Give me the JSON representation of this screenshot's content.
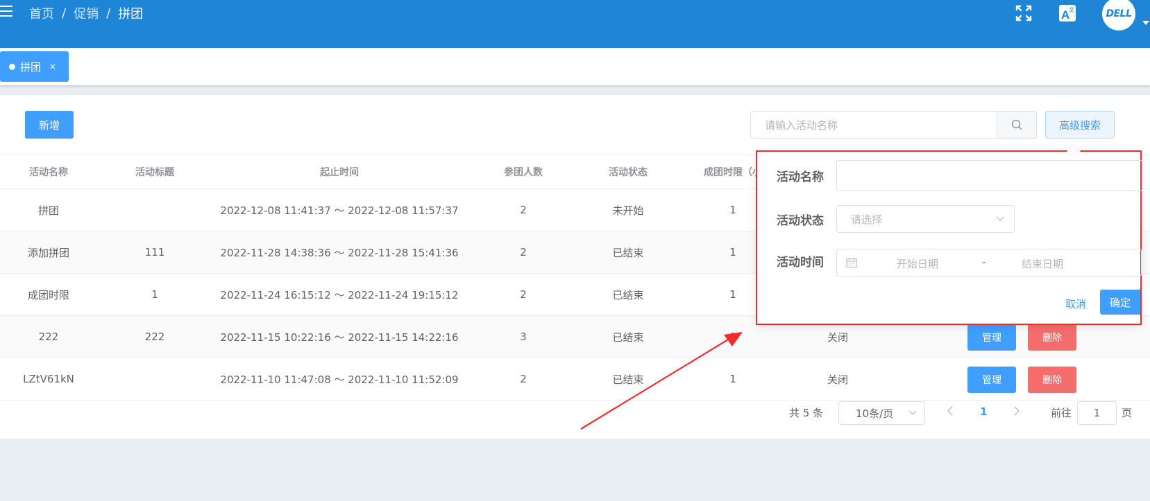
{
  "header": {
    "breadcrumb": [
      "首页",
      "促销",
      "拼团"
    ],
    "separator": "/",
    "avatar_text": "DELL",
    "icons": [
      "menu-icon",
      "fullscreen-icon",
      "translate-icon"
    ],
    "background_color": "#1f85d6"
  },
  "tabs": [
    {
      "label": "拼团",
      "close": "×"
    }
  ],
  "toolbar": {
    "add_label": "新增",
    "search_placeholder": "请输入活动名称",
    "advanced_search_label": "高级搜索"
  },
  "table": {
    "columns": [
      "活动名称",
      "活动标题",
      "起止时间",
      "参团人数",
      "活动状态",
      "成团时限（小"
    ],
    "rows": [
      {
        "name": "拼团",
        "title": "",
        "time": "2022-12-08 11:41:37 ～ 2022-12-08 11:57:37",
        "members": "2",
        "status": "未开始",
        "limit": "1",
        "state": "",
        "actions": false
      },
      {
        "name": "添加拼团",
        "title": "111",
        "time": "2022-11-28 14:38:36 ～ 2022-11-28 15:41:36",
        "members": "2",
        "status": "已结束",
        "limit": "1",
        "state": "",
        "actions": false
      },
      {
        "name": "成团时限",
        "title": "1",
        "time": "2022-11-24 16:15:12 ～ 2022-11-24 19:15:12",
        "members": "2",
        "status": "已结束",
        "limit": "1",
        "state": "",
        "actions": false
      },
      {
        "name": "222",
        "title": "222",
        "time": "2022-11-15 10:22:16 ～ 2022-11-15 14:22:16",
        "members": "3",
        "status": "已结束",
        "limit": "0",
        "state": "关闭",
        "actions": true
      },
      {
        "name": "LZtV61kN",
        "title": "",
        "time": "2022-11-10 11:47:08 ～ 2022-11-10 11:52:09",
        "members": "2",
        "status": "已结束",
        "limit": "1",
        "state": "关闭",
        "actions": true
      }
    ],
    "manage_label": "管理",
    "delete_label": "删除"
  },
  "pagination": {
    "total": "共 5 条",
    "page_size": "10条/页",
    "current_page": "1",
    "goto_prefix": "前往",
    "goto_value": "1",
    "goto_suffix": "页"
  },
  "advanced_search": {
    "name_label": "活动名称",
    "name_value": "",
    "status_label": "活动状态",
    "status_placeholder": "请选择",
    "time_label": "活动时间",
    "start_placeholder": "开始日期",
    "range_separator": "-",
    "end_placeholder": "结束日期",
    "cancel_label": "取消",
    "confirm_label": "确定",
    "highlight_color": "#f22c2c"
  }
}
